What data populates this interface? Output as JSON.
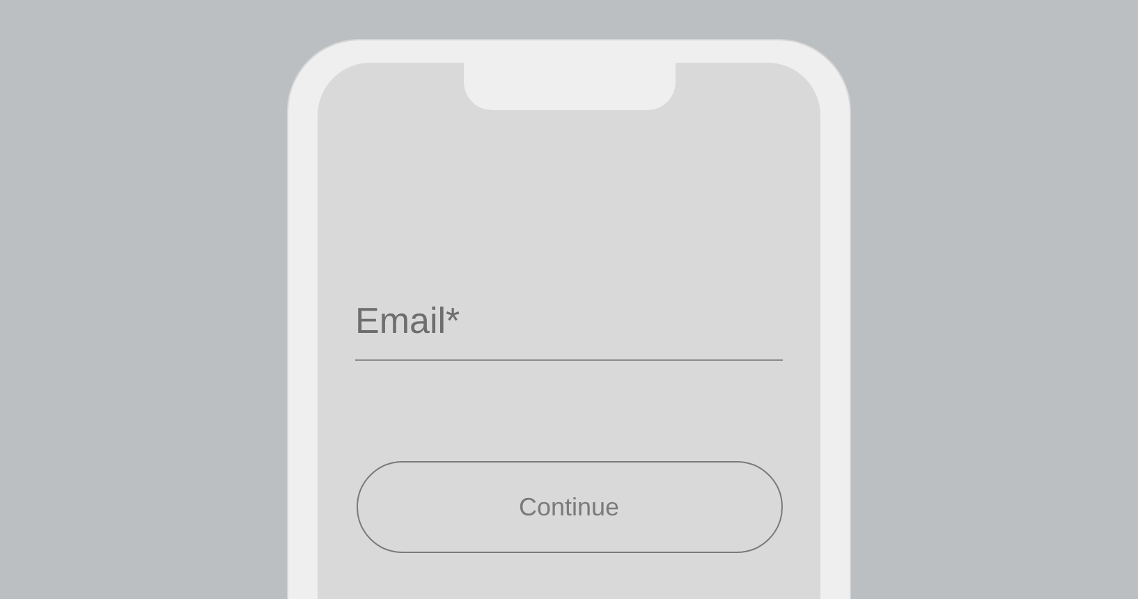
{
  "email_field": {
    "placeholder": "Email*"
  },
  "continue_button": {
    "label": "Continue"
  }
}
